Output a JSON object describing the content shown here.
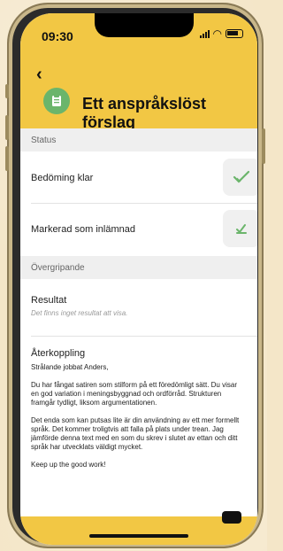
{
  "status_bar": {
    "time": "09:30"
  },
  "header": {
    "title": "Ett anspråkslöst förslag"
  },
  "sections": {
    "status_label": "Status",
    "overall_label": "Övergripande"
  },
  "status_rows": [
    {
      "label": "Bedöming klar"
    },
    {
      "label": "Markerad som inlämnad"
    }
  ],
  "result": {
    "title": "Resultat",
    "empty_text": "Det finns inget resultat att visa."
  },
  "feedback": {
    "title": "Återkoppling",
    "p1": "Strålande jobbat Anders,",
    "p2": "Du har fångat satiren som stilform på ett föredömligt sätt. Du visar en god variation i meningsbyggnad och ordförråd. Strukturen framgår tydligt, liksom argumentationen.",
    "p3": "Det enda som kan putsas lite är din användning av ett mer formellt språk. Det kommer troligtvis att falla på plats under trean. Jag jämförde denna text med en som du skrev i slutet av ettan och ditt språk har utvecklats väldigt mycket.",
    "p4": "Keep up the good work!"
  }
}
